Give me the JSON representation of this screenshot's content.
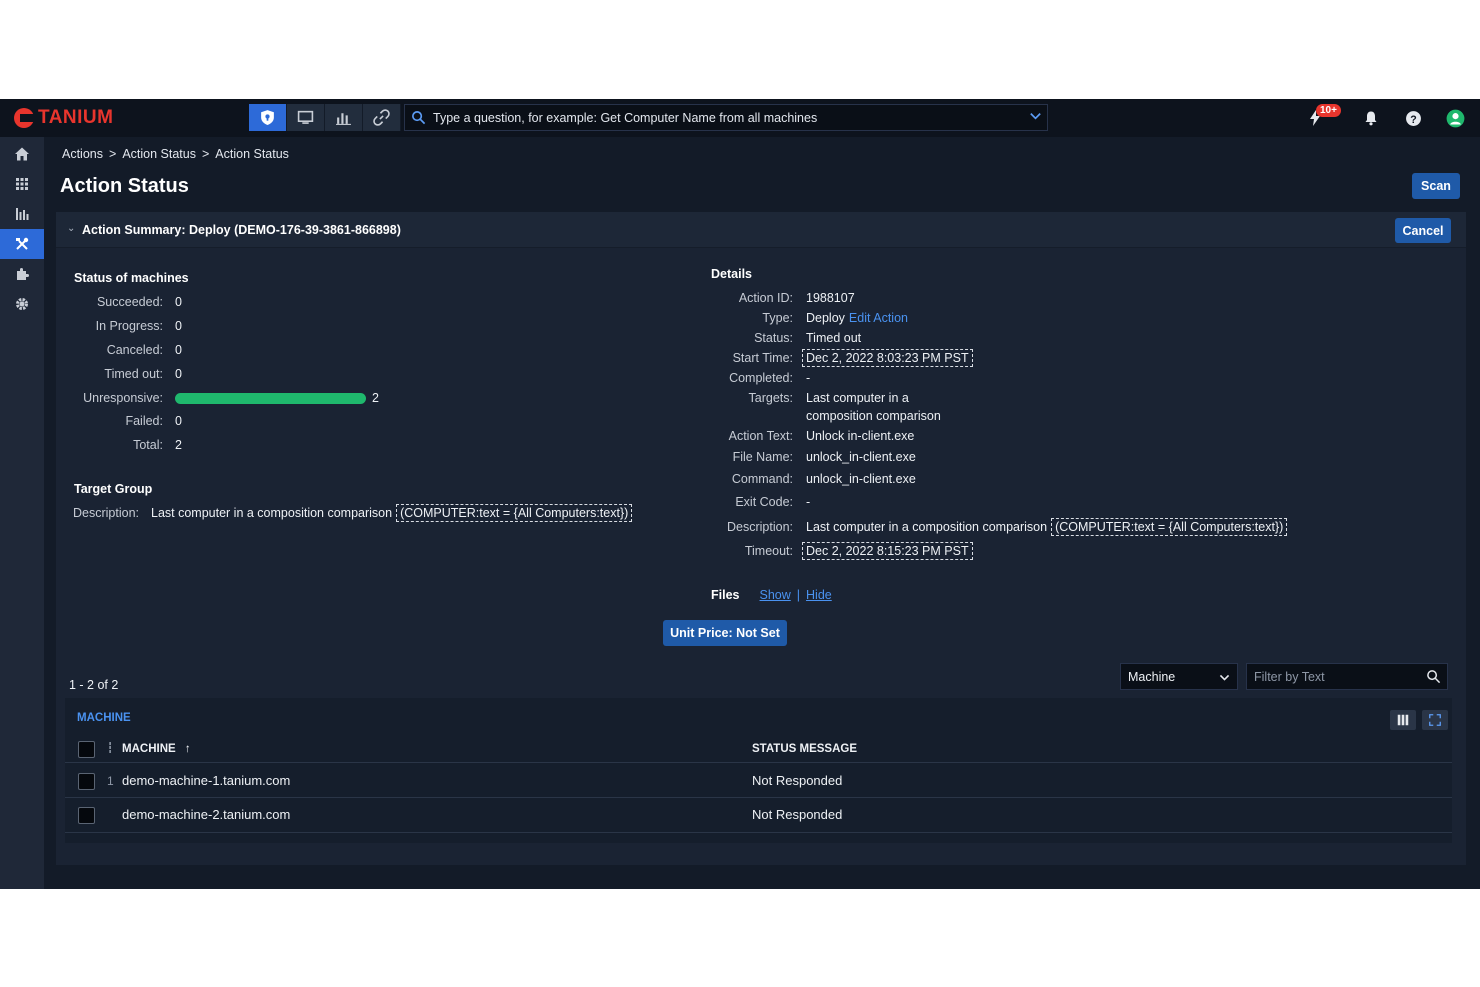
{
  "app": {
    "brand": "TANIUM"
  },
  "search": {
    "placeholder": "Type a question, for example: Get Computer Name from all machines"
  },
  "notifications": {
    "badge": "10+"
  },
  "breadcrumb": {
    "items": [
      "Actions",
      "Action Status",
      "Action Status"
    ],
    "separator": ">"
  },
  "page": {
    "title": "Action Status",
    "scan_label": "Scan"
  },
  "summary": {
    "title": "Action Summary: Deploy (DEMO-176-39-3861-866898)",
    "cancel_label": "Cancel"
  },
  "status_of_machines": {
    "title": "Status of machines",
    "rows": [
      {
        "label": "Succeeded:",
        "value": "0"
      },
      {
        "label": "In Progress:",
        "value": "0"
      },
      {
        "label": "Canceled:",
        "value": "0"
      },
      {
        "label": "Timed out:",
        "value": "0"
      },
      {
        "label": "Unresponsive:",
        "value": "2"
      },
      {
        "label": "Failed:",
        "value": "0"
      },
      {
        "label": "Total:",
        "value": "2"
      }
    ],
    "unresponsive_fraction": 1.0,
    "bar_color": "#1fb86d"
  },
  "target_group": {
    "title": "Target Group",
    "description_label": "Description:",
    "description_text": "Last computer in a composition comparison",
    "description_filter": "(COMPUTER:text = {All Computers:text})"
  },
  "details": {
    "title": "Details",
    "action_id_label": "Action ID:",
    "action_id": "1988107",
    "type_label": "Type:",
    "type": "Deploy",
    "edit_link": "Edit Action",
    "status_label": "Status:",
    "status": "Timed out",
    "start_time_label": "Start Time:",
    "start_time": "Dec 2, 2022 8:03:23 PM PST",
    "completed_label": "Completed:",
    "completed": "-",
    "targets_label": "Targets:",
    "targets_line1": "Last computer in a",
    "targets_line2": "composition comparison",
    "action_text_label": "Action Text:",
    "action_text": "Unlock in-client.exe",
    "file_name_label": "File Name:",
    "file_name": "unlock_in-client.exe",
    "command_label": "Command:",
    "command": "unlock_in-client.exe",
    "exit_code_label": "Exit Code:",
    "exit_code": "-",
    "description_label": "Description:",
    "description_text": "Last computer in a composition comparison",
    "description_filter": "(COMPUTER:text = {All Computers:text})",
    "timeout_label": "Timeout:",
    "timeout": "Dec 2, 2022 8:15:23 PM PST"
  },
  "files": {
    "label": "Files",
    "show": "Show",
    "divider": "|",
    "hide": "Hide"
  },
  "unit_price_label": "Unit Price: Not Set",
  "results": {
    "count": "1 - 2 of 2",
    "group_by": "Machine",
    "filter_placeholder": "Filter by Text",
    "tab_label": "MACHINE",
    "columns": [
      "MACHINE",
      "STATUS MESSAGE"
    ],
    "sort_indicator": "↑",
    "rows": [
      {
        "num": "1",
        "machine": "demo-machine-1.tanium.com",
        "status": "Not Responded"
      },
      {
        "num": "",
        "machine": "demo-machine-2.tanium.com",
        "status": "Not Responded"
      }
    ]
  },
  "colors": {
    "accent": "#2d6ad8",
    "brand": "#e8352d",
    "link": "#4a92f0",
    "background": "#131b28"
  }
}
